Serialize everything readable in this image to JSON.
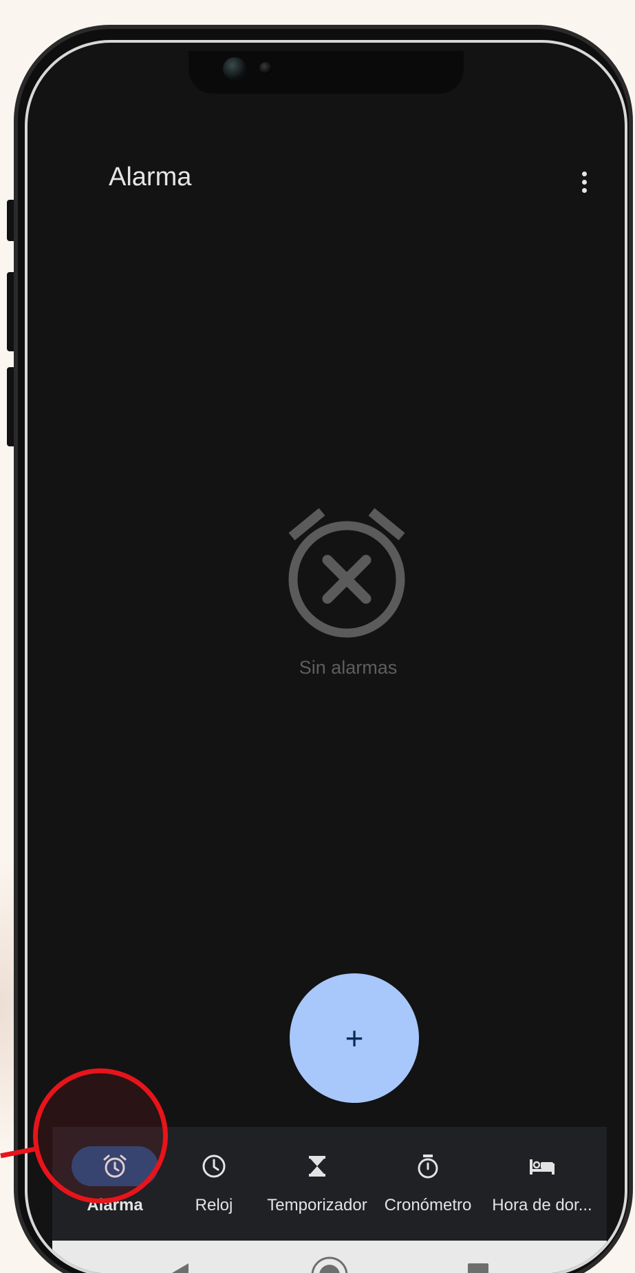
{
  "app": {
    "title": "Alarma",
    "more_options_icon": "more-vert-icon"
  },
  "empty_state": {
    "icon": "alarm-off-icon",
    "text": "Sin alarmas"
  },
  "fab": {
    "label": "+",
    "icon": "add-icon",
    "color": "#a8c7fa"
  },
  "bottom_nav": {
    "items": [
      {
        "label": "Alarma",
        "icon": "alarm-icon",
        "active": true
      },
      {
        "label": "Reloj",
        "icon": "clock-icon",
        "active": false
      },
      {
        "label": "Temporizador",
        "icon": "hourglass-icon",
        "active": false
      },
      {
        "label": "Cronómetro",
        "icon": "stopwatch-icon",
        "active": false
      },
      {
        "label": "Hora de dor...",
        "icon": "bed-icon",
        "active": false
      }
    ]
  },
  "system_nav": {
    "back_icon": "back-triangle-icon",
    "home_icon": "home-circle-icon",
    "recents_icon": "recents-square-icon"
  },
  "colors": {
    "background": "#131313",
    "nav_background": "#1f2125",
    "active_pill": "#234a7a",
    "annotation": "#e8141b",
    "page_background": "#fbf5ef"
  }
}
